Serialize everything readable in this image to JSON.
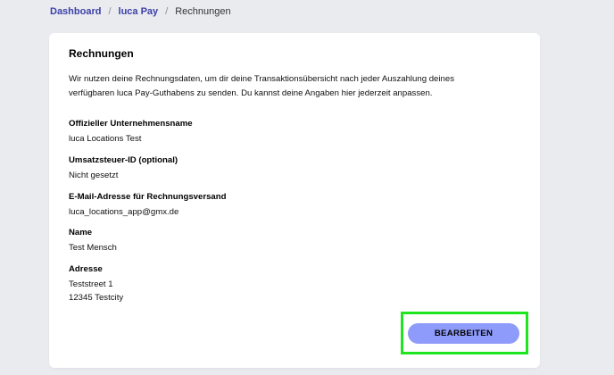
{
  "breadcrumb": {
    "dashboard": "Dashboard",
    "sep1": "/",
    "luca_pay": "luca Pay",
    "sep2": "/",
    "current": "Rechnungen"
  },
  "card": {
    "title": "Rechnungen",
    "description": "Wir nutzen deine Rechnungsdaten, um dir deine Transaktionsübersicht nach jeder Auszahlung deines verfügbaren luca Pay-Guthabens zu senden. Du kannst deine Angaben hier jederzeit anpassen.",
    "fields": [
      {
        "label": "Offizieller Unternehmensname",
        "value": "luca Locations Test"
      },
      {
        "label": "Umsatzsteuer-ID (optional)",
        "value": "Nicht gesetzt"
      },
      {
        "label": "E-Mail-Adresse für Rechnungsversand",
        "value": "luca_locations_app@gmx.de"
      },
      {
        "label": "Name",
        "value": "Test Mensch"
      },
      {
        "label": "Adresse",
        "value": "Teststreet 1",
        "value2": "12345 Testcity"
      }
    ],
    "edit_button": "BEARBEITEN"
  },
  "colors": {
    "accent": "#3c3fa8",
    "button": "#8e9bfa",
    "highlight": "#1ee61e",
    "background": "#e9ebef"
  }
}
